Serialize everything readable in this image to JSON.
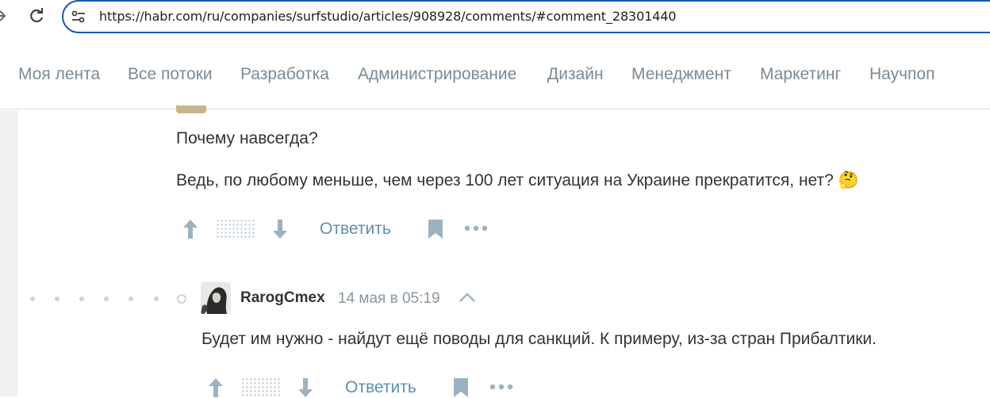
{
  "browser": {
    "url": "https://habr.com/ru/companies/surfstudio/articles/908928/comments/#comment_28301440"
  },
  "nav": {
    "items": [
      "Моя лента",
      "Все потоки",
      "Разработка",
      "Администрирование",
      "Дизайн",
      "Менеджмент",
      "Маркетинг",
      "Научпоп"
    ]
  },
  "comment1": {
    "line1": "Почему навсегда?",
    "line2": "Ведь, по любому меньше, чем через 100 лет ситуация на Украине прекратится, нет? 🤔",
    "reply_label": "Ответить"
  },
  "comment2": {
    "author": "RarogCmex",
    "date": "14 мая в 05:19",
    "text": "Будет им нужно - найдут ещё поводы для санкций. К примеру, из-за стран Прибалтики.",
    "reply_label": "Ответить"
  },
  "icons": {
    "forward": "forward-arrow-icon",
    "reload": "reload-icon",
    "site_info": "site-info-icon",
    "upvote": "upvote-arrow-icon",
    "downvote": "downvote-arrow-icon",
    "bookmark": "bookmark-icon",
    "more": "more-dots-icon",
    "collapse": "chevron-up-icon"
  },
  "colors": {
    "address_border": "#1a56b0",
    "nav_text": "#7b8a95",
    "reply_link": "#5e8eac",
    "action_icon": "#9db2c1"
  }
}
